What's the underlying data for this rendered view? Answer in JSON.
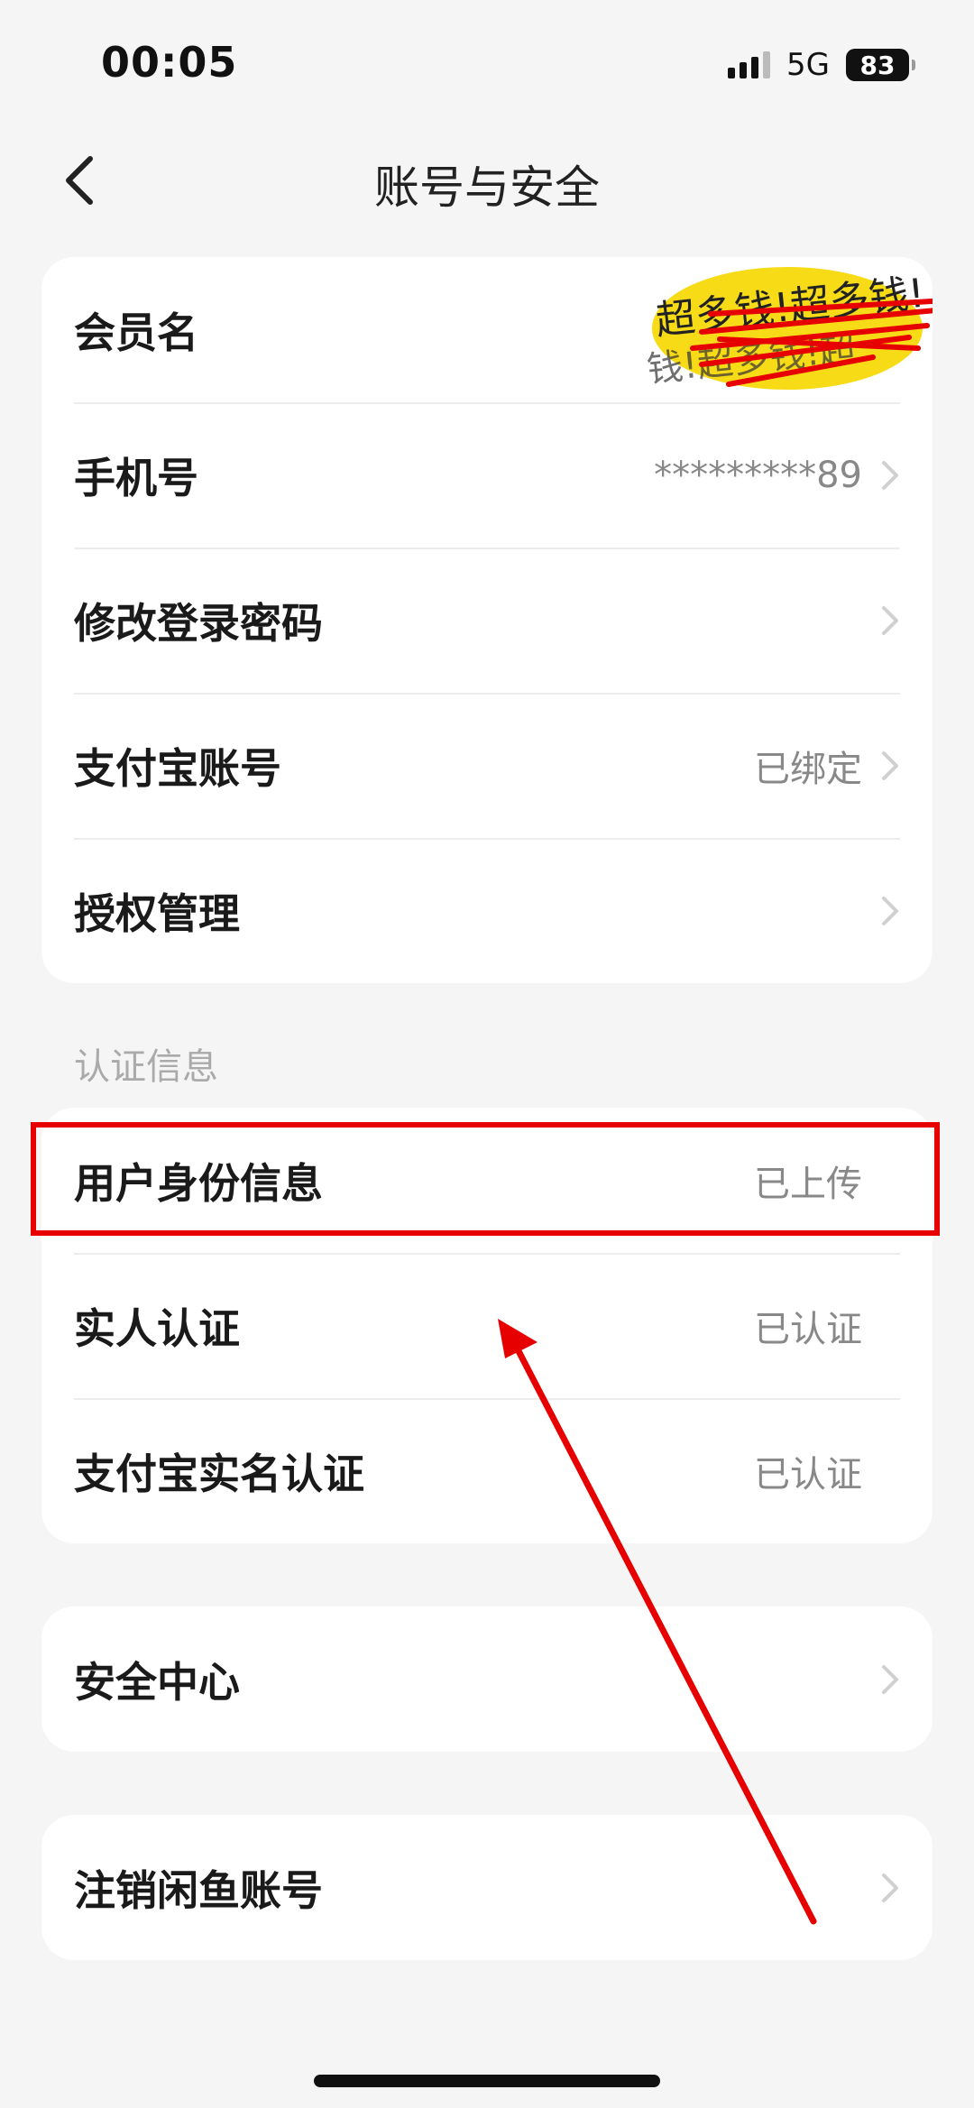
{
  "status": {
    "time": "00:05",
    "network": "5G",
    "battery": "83"
  },
  "nav": {
    "title": "账号与安全"
  },
  "account": {
    "member_name": {
      "label": "会员名",
      "value": "超多钱!超多钱!"
    },
    "phone": {
      "label": "手机号",
      "value": "*********89"
    },
    "change_password": {
      "label": "修改登录密码"
    },
    "alipay": {
      "label": "支付宝账号",
      "value": "已绑定"
    },
    "auth": {
      "label": "授权管理"
    }
  },
  "verification": {
    "section_title": "认证信息",
    "identity": {
      "label": "用户身份信息",
      "value": "已上传"
    },
    "real_person": {
      "label": "实人认证",
      "value": "已认证"
    },
    "alipay_real_name": {
      "label": "支付宝实名认证",
      "value": "已认证"
    }
  },
  "security_center": {
    "label": "安全中心"
  },
  "deactivate": {
    "label": "注销闲鱼账号"
  },
  "colors": {
    "accent_red": "#e60000",
    "sticker_yellow": "#f5d90a",
    "background": "#f5f5f5"
  },
  "icons": [
    "back-chevron-icon",
    "chevron-right-icon",
    "signal-icon",
    "battery-icon"
  ]
}
